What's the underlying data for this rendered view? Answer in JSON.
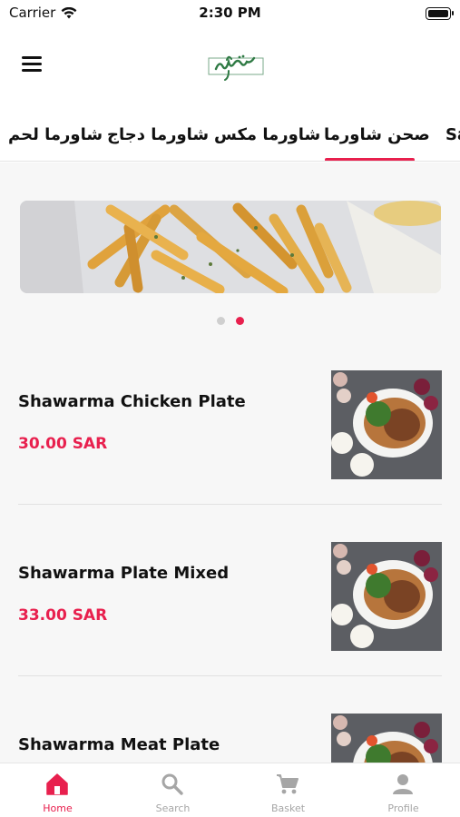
{
  "status_bar": {
    "carrier": "Carrier",
    "time": "2:30 PM",
    "wifi_icon": "wifi-icon",
    "battery_icon": "battery-icon"
  },
  "header": {
    "menu_icon": "hamburger-menu-icon",
    "logo_icon": "brand-logo"
  },
  "tabs": [
    {
      "label": "Sa",
      "active": false
    },
    {
      "label": "صحن شاورما",
      "active": true
    },
    {
      "label": "شاورما مكس",
      "active": false
    },
    {
      "label": "شاورما دجاج",
      "active": false
    },
    {
      "label": "شاورما لحم",
      "active": false
    }
  ],
  "banner": {
    "image": "french-fries-photo",
    "pagination": {
      "total": 2,
      "active_index": 1
    }
  },
  "menu_items": [
    {
      "name": "Shawarma Chicken Plate",
      "price": "30.00 SAR",
      "image": "shawarma-plate-photo"
    },
    {
      "name": "Shawarma Plate Mixed",
      "price": "33.00 SAR",
      "image": "shawarma-plate-photo"
    },
    {
      "name": "Shawarma Meat Plate",
      "price": "",
      "image": "shawarma-plate-photo"
    }
  ],
  "bottom_nav": [
    {
      "label": "Home",
      "icon": "home-icon",
      "active": true
    },
    {
      "label": "Search",
      "icon": "search-icon",
      "active": false
    },
    {
      "label": "Basket",
      "icon": "cart-icon",
      "active": false
    },
    {
      "label": "Profile",
      "icon": "person-icon",
      "active": false
    }
  ],
  "colors": {
    "accent": "#e8204e",
    "inactive_nav": "#a6a6a6",
    "content_bg": "#f7f7f7",
    "logo_green": "#3c8a4e"
  }
}
